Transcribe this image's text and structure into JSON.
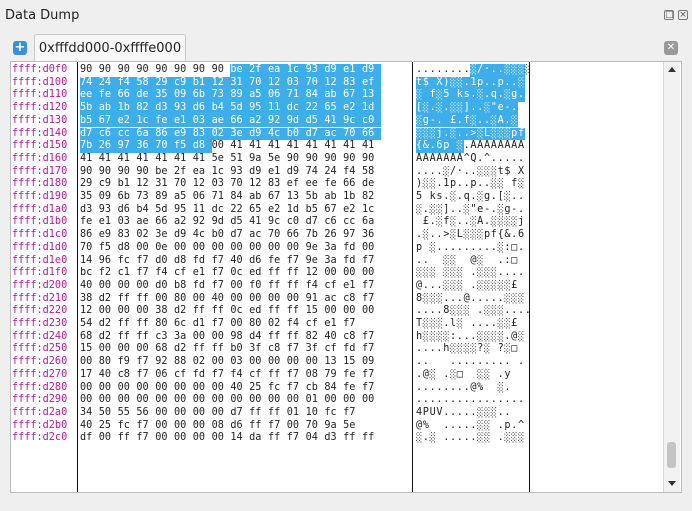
{
  "window": {
    "title": "Data Dump"
  },
  "tabs": [
    {
      "label": "0xfffdd000-0xffffe000"
    }
  ],
  "selection_color": "#3daee9",
  "address_color": "#b8179c",
  "rows": [
    {
      "addr": "ffff:d0f0",
      "hex": [
        "90",
        "90",
        "90",
        "90",
        "90",
        "90",
        "90",
        "90",
        "be",
        "2f",
        "ea",
        "1c",
        "93",
        "d9",
        "e1",
        "d9"
      ],
      "ascii": "........░/·..░░░░",
      "sel_start": 8
    },
    {
      "addr": "ffff:d100",
      "hex": [
        "74",
        "24",
        "f4",
        "58",
        "29",
        "c9",
        "b1",
        "12",
        "31",
        "70",
        "12",
        "03",
        "70",
        "12",
        "83",
        "ef"
      ],
      "ascii": "t$ X)░░.1p..p..░",
      "sel_start": 0
    },
    {
      "addr": "ffff:d110",
      "hex": [
        "ee",
        "fe",
        "66",
        "de",
        "35",
        "09",
        "6b",
        "73",
        "89",
        "a5",
        "06",
        "71",
        "84",
        "ab",
        "67",
        "13"
      ],
      "ascii": "░ f░5 ks.░.q.░g.",
      "sel_start": 0
    },
    {
      "addr": "ffff:d120",
      "hex": [
        "5b",
        "ab",
        "1b",
        "82",
        "d3",
        "93",
        "d6",
        "b4",
        "5d",
        "95",
        "11",
        "dc",
        "22",
        "65",
        "e2",
        "1d"
      ],
      "ascii": "[░.░.░░]..░\"e-.",
      "sel_start": 0
    },
    {
      "addr": "ffff:d130",
      "hex": [
        "b5",
        "67",
        "e2",
        "1c",
        "fe",
        "e1",
        "03",
        "ae",
        "66",
        "a2",
        "92",
        "9d",
        "d5",
        "41",
        "9c",
        "c0"
      ],
      "ascii": "░g-. £.f░..░A.░",
      "sel_start": 0
    },
    {
      "addr": "ffff:d140",
      "hex": [
        "d7",
        "c6",
        "cc",
        "6a",
        "86",
        "e9",
        "83",
        "02",
        "3e",
        "d9",
        "4c",
        "b0",
        "d7",
        "ac",
        "70",
        "66"
      ],
      "ascii": "░░░j.░..>░L░░░pf",
      "sel_start": 0
    },
    {
      "addr": "ffff:d150",
      "hex": [
        "7b",
        "26",
        "97",
        "36",
        "70",
        "f5",
        "d8",
        "00",
        "41",
        "41",
        "41",
        "41",
        "41",
        "41",
        "41",
        "41"
      ],
      "ascii": "{&.6p ░.AAAAAAAA",
      "sel_start": 0,
      "sel_end": 7
    },
    {
      "addr": "ffff:d160",
      "hex": [
        "41",
        "41",
        "41",
        "41",
        "41",
        "41",
        "41",
        "5e",
        "51",
        "9a",
        "5e",
        "90",
        "90",
        "90",
        "90",
        "90"
      ],
      "ascii": "AAAAAAA^Q.^....."
    },
    {
      "addr": "ffff:d170",
      "hex": [
        "90",
        "90",
        "90",
        "90",
        "be",
        "2f",
        "ea",
        "1c",
        "93",
        "d9",
        "e1",
        "d9",
        "74",
        "24",
        "f4",
        "58"
      ],
      "ascii": "....░/·..░░░t$ X"
    },
    {
      "addr": "ffff:d180",
      "hex": [
        "29",
        "c9",
        "b1",
        "12",
        "31",
        "70",
        "12",
        "03",
        "70",
        "12",
        "83",
        "ef",
        "ee",
        "fe",
        "66",
        "de"
      ],
      "ascii": ")░░.1p..p..░░ f░"
    },
    {
      "addr": "ffff:d190",
      "hex": [
        "35",
        "09",
        "6b",
        "73",
        "89",
        "a5",
        "06",
        "71",
        "84",
        "ab",
        "67",
        "13",
        "5b",
        "ab",
        "1b",
        "82"
      ],
      "ascii": "5 ks.░.q.░g.[░.."
    },
    {
      "addr": "ffff:d1a0",
      "hex": [
        "d3",
        "93",
        "d6",
        "b4",
        "5d",
        "95",
        "11",
        "dc",
        "22",
        "65",
        "e2",
        "1d",
        "b5",
        "67",
        "e2",
        "1c"
      ],
      "ascii": "░.░░]..░\"e-.░g-."
    },
    {
      "addr": "ffff:d1b0",
      "hex": [
        "fe",
        "e1",
        "03",
        "ae",
        "66",
        "a2",
        "92",
        "9d",
        "d5",
        "41",
        "9c",
        "c0",
        "d7",
        "c6",
        "cc",
        "6a"
      ],
      "ascii": " £.░f░..░A.░░░░j"
    },
    {
      "addr": "ffff:d1c0",
      "hex": [
        "86",
        "e9",
        "83",
        "02",
        "3e",
        "d9",
        "4c",
        "b0",
        "d7",
        "ac",
        "70",
        "66",
        "7b",
        "26",
        "97",
        "36"
      ],
      "ascii": ".░..>░L░░░pf{&.6"
    },
    {
      "addr": "ffff:d1d0",
      "hex": [
        "70",
        "f5",
        "d8",
        "00",
        "0e",
        "00",
        "00",
        "00",
        "00",
        "00",
        "00",
        "00",
        "9e",
        "3a",
        "fd",
        "00"
      ],
      "ascii": "p ░.........░:□."
    },
    {
      "addr": "ffff:d1e0",
      "hex": [
        "14",
        "96",
        "fc",
        "f7",
        "d0",
        "d8",
        "fd",
        "f7",
        "40",
        "d6",
        "fe",
        "f7",
        "9e",
        "3a",
        "fd",
        "f7"
      ],
      "ascii": "..  ░░  @░  .:□ "
    },
    {
      "addr": "ffff:d1f0",
      "hex": [
        "bc",
        "f2",
        "c1",
        "f7",
        "f4",
        "cf",
        "e1",
        "f7",
        "0c",
        "ed",
        "ff",
        "ff",
        "12",
        "00",
        "00",
        "00"
      ],
      "ascii": "░░░ ░░░ .░░░...."
    },
    {
      "addr": "ffff:d200",
      "hex": [
        "40",
        "00",
        "00",
        "00",
        "d0",
        "b8",
        "fd",
        "f7",
        "00",
        "f0",
        "ff",
        "ff",
        "f4",
        "cf",
        "e1",
        "f7"
      ],
      "ascii": "@...░░░ .░░░░░£ "
    },
    {
      "addr": "ffff:d210",
      "hex": [
        "38",
        "d2",
        "ff",
        "ff",
        "00",
        "80",
        "00",
        "40",
        "00",
        "00",
        "00",
        "00",
        "91",
        "ac",
        "c8",
        "f7"
      ],
      "ascii": "8░░░...@.....░░░ "
    },
    {
      "addr": "ffff:d220",
      "hex": [
        "12",
        "00",
        "00",
        "00",
        "38",
        "d2",
        "ff",
        "ff",
        "0c",
        "ed",
        "ff",
        "ff",
        "15",
        "00",
        "00",
        "00"
      ],
      "ascii": "....8░░░ .░░░...."
    },
    {
      "addr": "ffff:d230",
      "hex": [
        "54",
        "d2",
        "ff",
        "ff",
        "80",
        "6c",
        "d1",
        "f7",
        "00",
        "80",
        "02",
        "f4",
        "cf",
        "e1",
        "f7"
      ],
      "ascii": "T░░░.l░ ....░░£ "
    },
    {
      "addr": "ffff:d240",
      "hex": [
        "68",
        "d2",
        "ff",
        "ff",
        "c3",
        "3a",
        "00",
        "00",
        "98",
        "d4",
        "ff",
        "ff",
        "82",
        "40",
        "c8",
        "f7"
      ],
      "ascii": "h░░░░:...░░░░.@░ "
    },
    {
      "addr": "ffff:d250",
      "hex": [
        "15",
        "00",
        "00",
        "00",
        "68",
        "d2",
        "ff",
        "ff",
        "b0",
        "3f",
        "c8",
        "f7",
        "3f",
        "cf",
        "fd",
        "f7"
      ],
      "ascii": "....h░░░░?░ ?░□ "
    },
    {
      "addr": "ffff:d260",
      "hex": [
        "00",
        "80",
        "f9",
        "f7",
        "92",
        "88",
        "02",
        "00",
        "03",
        "00",
        "00",
        "00",
        "00",
        "13",
        "15",
        "09"
      ],
      "ascii": "..   ......... ."
    },
    {
      "addr": "ffff:d270",
      "hex": [
        "17",
        "40",
        "c8",
        "f7",
        "06",
        "cf",
        "fd",
        "f7",
        "f4",
        "cf",
        "ff",
        "f7",
        "08",
        "79",
        "fe",
        "f7"
      ],
      "ascii": ".@░ .░□  ░░ .y "
    },
    {
      "addr": "ffff:d280",
      "hex": [
        "00",
        "00",
        "00",
        "00",
        "00",
        "00",
        "00",
        "00",
        "40",
        "25",
        "fc",
        "f7",
        "cb",
        "84",
        "fe",
        "f7"
      ],
      "ascii": "........@%  ░.  "
    },
    {
      "addr": "ffff:d290",
      "hex": [
        "00",
        "00",
        "00",
        "00",
        "00",
        "00",
        "00",
        "00",
        "00",
        "00",
        "00",
        "00",
        "01",
        "00",
        "00",
        "00"
      ],
      "ascii": "................"
    },
    {
      "addr": "ffff:d2a0",
      "hex": [
        "34",
        "50",
        "55",
        "56",
        "00",
        "00",
        "00",
        "00",
        "d7",
        "ff",
        "ff",
        "01",
        "10",
        "fc",
        "f7"
      ],
      "ascii": "4PUV.....░░░..  "
    },
    {
      "addr": "ffff:d2b0",
      "hex": [
        "40",
        "25",
        "fc",
        "f7",
        "00",
        "00",
        "00",
        "08",
        "d6",
        "ff",
        "f7",
        "00",
        "70",
        "9a",
        "5e"
      ],
      "ascii": "@%  .....░░ .p.^"
    },
    {
      "addr": "ffff:d2c0",
      "hex": [
        "df",
        "00",
        "ff",
        "f7",
        "00",
        "00",
        "00",
        "00",
        "14",
        "da",
        "ff",
        "f7",
        "04",
        "d3",
        "ff",
        "ff"
      ],
      "ascii": "░.░ .....░░ .░░░"
    }
  ]
}
